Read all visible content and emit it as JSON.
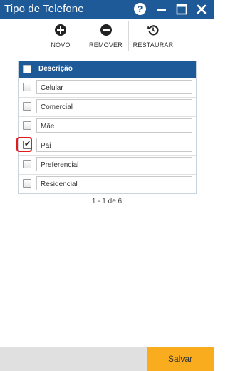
{
  "window": {
    "title": "Tipo de Telefone"
  },
  "toolbar": {
    "novo_label": "NOVO",
    "remover_label": "REMOVER",
    "restaurar_label": "RESTAURAR"
  },
  "grid": {
    "header": "Descrição",
    "rows": [
      {
        "label": "Celular",
        "checked": false
      },
      {
        "label": "Comercial",
        "checked": false
      },
      {
        "label": "Mãe",
        "checked": false
      },
      {
        "label": "Pai",
        "checked": true
      },
      {
        "label": "Preferencial",
        "checked": false
      },
      {
        "label": "Residencial",
        "checked": false
      }
    ]
  },
  "pager": {
    "text": "1 - 1 de 6"
  },
  "footer": {
    "save_label": "Salvar"
  },
  "colors": {
    "primary": "#1d5a97",
    "accent": "#f9ad1e",
    "highlight": "#e21b1b"
  }
}
